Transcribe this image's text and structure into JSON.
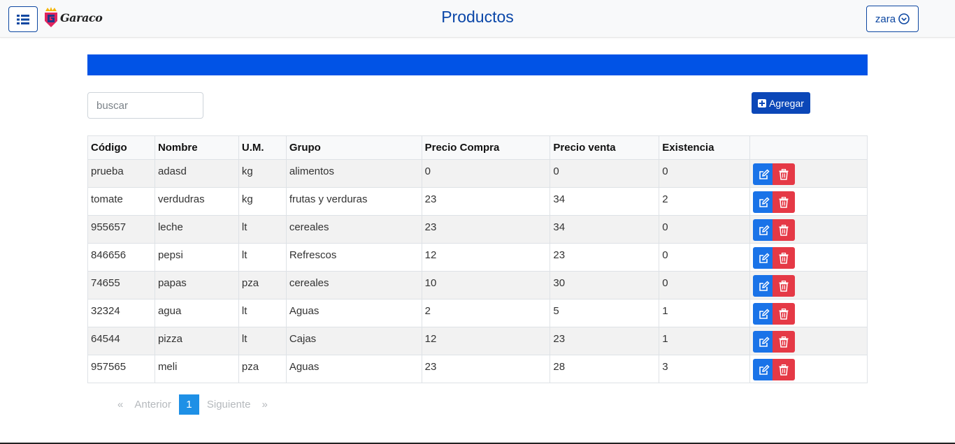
{
  "header": {
    "logo_text": "Garaco",
    "title": "Productos",
    "user_label": "zara"
  },
  "search": {
    "placeholder": "buscar",
    "value": ""
  },
  "toolbar": {
    "add_label": "Agregar"
  },
  "table": {
    "columns": [
      "Código",
      "Nombre",
      "U.M.",
      "Grupo",
      "Precio Compra",
      "Precio venta",
      "Existencia",
      ""
    ],
    "rows": [
      [
        "prueba",
        "adasd",
        "kg",
        "alimentos",
        "0",
        "0",
        "0"
      ],
      [
        "tomate",
        "verdudras",
        "kg",
        "frutas y verduras",
        "23",
        "34",
        "2"
      ],
      [
        "955657",
        "leche",
        "lt",
        "cereales",
        "23",
        "34",
        "0"
      ],
      [
        "846656",
        "pepsi",
        "lt",
        "Refrescos",
        "12",
        "23",
        "0"
      ],
      [
        "74655",
        "papas",
        "pza",
        "cereales",
        "10",
        "30",
        "0"
      ],
      [
        "32324",
        "agua",
        "lt",
        "Aguas",
        "2",
        "5",
        "1"
      ],
      [
        "64544",
        "pizza",
        "lt",
        "Cajas",
        "12",
        "23",
        "1"
      ],
      [
        "957565",
        "meli",
        "pza",
        "Aguas",
        "23",
        "28",
        "3"
      ]
    ]
  },
  "pagination": {
    "prev_symbol": "«",
    "prev_label": "Anterior",
    "current_page": "1",
    "next_label": "Siguiente",
    "next_symbol": "»"
  },
  "colors": {
    "brand": "#0b47a8",
    "band": "#0153e6",
    "edit": "#1a73e8",
    "delete": "#e53946",
    "page_active": "#1e90e6"
  },
  "icons": {
    "menu": "list-icon",
    "user_dropdown": "chevron-circle-down-icon",
    "add": "plus-square-icon",
    "edit": "edit-icon",
    "delete": "trash-icon"
  }
}
